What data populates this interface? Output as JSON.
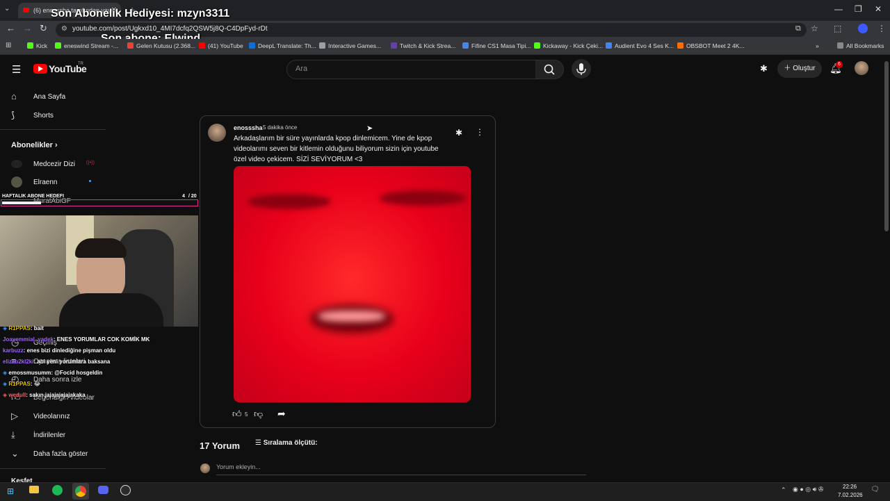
{
  "browser": {
    "tab_title": "(6) enosssha tarafından yayın...",
    "url": "youtube.com/post/Ugkxd10_4MI7dcfq2QSW5j8Q-C4DpFyd-rDt",
    "bookmarks": [
      {
        "label": "Kick",
        "color": "#53fc18"
      },
      {
        "label": "eneswind Stream -...",
        "color": "#53fc18"
      },
      {
        "label": "Gelen Kutusu (2.368...",
        "color": "#ea4335"
      },
      {
        "label": "(41) YouTube",
        "color": "#ff0000"
      },
      {
        "label": "DeepL Translate: Th...",
        "color": "#0f2b46"
      },
      {
        "label": "Interactive Games...",
        "color": "#9aa0a6"
      },
      {
        "label": "Twitch & Kick Strea...",
        "color": "#6441a5"
      },
      {
        "label": "Fifine CS1 Masa Tipi...",
        "color": "#4285f4"
      },
      {
        "label": "Kickaway - Kick Çeki...",
        "color": "#53fc18"
      },
      {
        "label": "Audient Evo 4 Ses K...",
        "color": "#4285f4"
      },
      {
        "label": "OBSBOT Meet 2 4K...",
        "color": "#ff6d00"
      }
    ],
    "all_bookmarks": "All Bookmarks"
  },
  "overlay": {
    "gift_text": "Son Abonelik Hediyesi: mzyn3311",
    "last_sub_text": "Son abone: Elwind",
    "goal_label": "HAFTALIK ABONE HEDEFI",
    "goal_count": "4",
    "goal_total": "/ 20",
    "goal_progress": 0.2
  },
  "youtube": {
    "logo": "YouTube",
    "logo_suffix": "TR",
    "search_placeholder": "Ara",
    "create_label": "Oluştur",
    "notif_count": "6"
  },
  "sidebar": {
    "home": "Ana Sayfa",
    "shorts": "Shorts",
    "subscriptions_header": "Abonelikler",
    "subs": [
      "Medcezir Dizi",
      "Elraenn",
      "MuratAbiGF"
    ],
    "history": "Geçmiş",
    "playlists": "Oynatma listeleri",
    "watch_later": "Daha sonra izle",
    "liked": "Beğendiğin videolar",
    "your_videos": "Videolarınız",
    "downloads": "İndirilenler",
    "show_more": "Daha fazla göster",
    "explore": "Keşfet"
  },
  "post": {
    "author": "enosssha",
    "time": "5 dakika önce",
    "text": "Arkadaşlarım bir süre yayınlarda kpop dinlemicem. Yine de kpop videolarımı seven bir kitlemin olduğunu biliyorum sizin için youtube özel video çekicem. SİZİ SEVİYORUM <3",
    "like_count": "5"
  },
  "comments": {
    "count_label": "17 Yorum",
    "sort_label": "Sıralama ölçütü:",
    "add_placeholder": "Yorum ekleyin..."
  },
  "chat": [
    {
      "user": "R1PPAS",
      "msg": ": bait",
      "color": "#e0c000"
    },
    {
      "user": "Joayemmial_yadek",
      "msg": ": ENES YORUMLAR COK KOMİK MK",
      "color": "#a066ff"
    },
    {
      "user": "karbuzz",
      "msg": ": enes bizi dinlediğine pişman oldu",
      "color": "#a066ff"
    },
    {
      "user": "elizab2kl2ki",
      "msg": ": abi yeni yorumlara baksana",
      "color": "#a066ff"
    },
    {
      "user": "emossmusumm",
      "msg": ": @Focid hosgeldin",
      "color": "#ffffff"
    },
    {
      "user": "R1PPAS",
      "msg": ": 😂",
      "color": "#e0c000"
    },
    {
      "user": "wedull",
      "msg": ": sakın jajajajajajakaka",
      "color": "#ff6060"
    }
  ],
  "taskbar": {
    "time": "22:26",
    "date": "7.02.2026"
  },
  "colors": {
    "bg": "#0f0f0f",
    "accent_red": "#ff0000",
    "goal_bar": "#e0308f"
  }
}
